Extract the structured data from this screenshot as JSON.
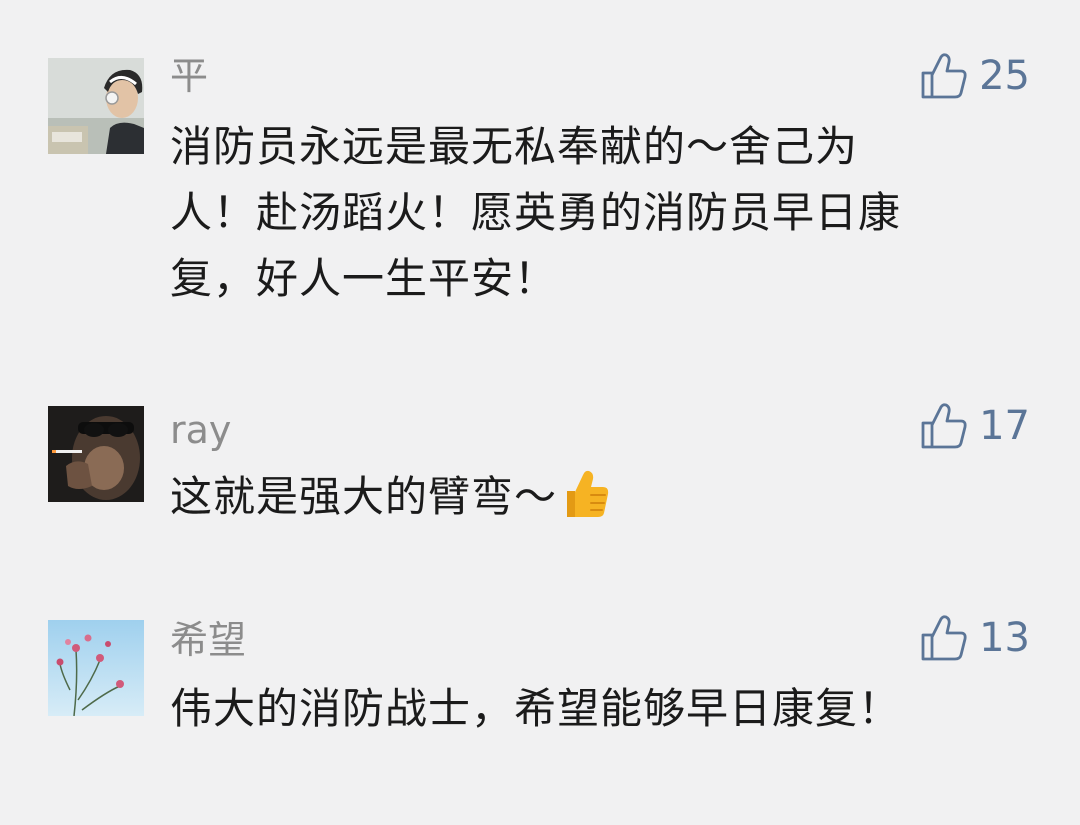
{
  "comments": [
    {
      "user": "平",
      "likes": "25",
      "lines": [
        "消防员永远是最无私奉献的～舍己为",
        "人！赴汤蹈火！愿英勇的消防员早日康",
        "复，好人一生平安！"
      ],
      "avatar_icon": "headphones-boy-avatar"
    },
    {
      "user": "ray",
      "likes": "17",
      "lines": [
        "这就是强大的臂弯～"
      ],
      "emoji": "thumbs-up-emoji",
      "avatar_icon": "monkey-smoking-avatar"
    },
    {
      "user": "希望",
      "likes": "13",
      "lines": [
        "伟大的消防战士，希望能够早日康复！"
      ],
      "avatar_icon": "flowers-sky-avatar"
    }
  ],
  "colors": {
    "background": "#f1f1f2",
    "username": "#8c8c8c",
    "text": "#1b1b1b",
    "like": "#5b7597",
    "emoji": "#f6b323"
  }
}
